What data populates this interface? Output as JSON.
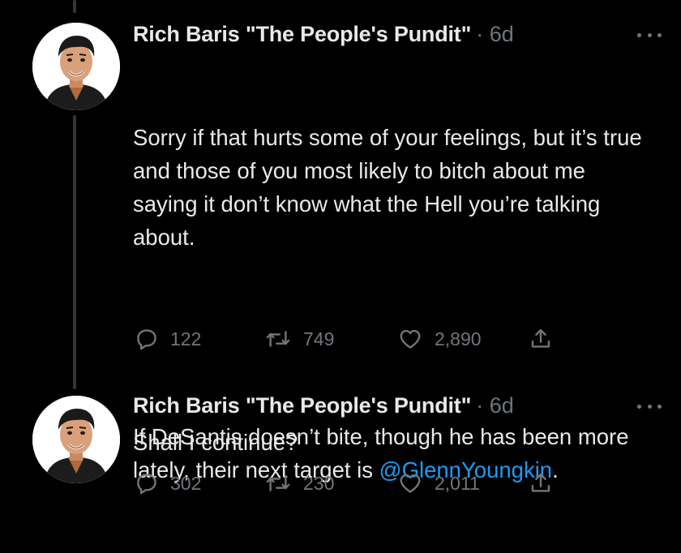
{
  "tweets": [
    {
      "author": "Rich Baris \"The People's Pundit\"",
      "meta": "· 6d",
      "paragraph1": "Sorry if that hurts some of your feelings, but it’s true and those of you most likely to bitch about me saying it don’t know what the Hell you’re talking about.",
      "paragraph2_prefix": "If DeSantis doesn’t bite, though he has been more lately, their next target is ",
      "mention": "@GlennYoungkin",
      "paragraph2_suffix": ".",
      "replies": "122",
      "retweets": "749",
      "likes": "2,890"
    },
    {
      "author": "Rich Baris \"The People's Pundit\"",
      "meta": "· 6d",
      "text": "Shall I continue?",
      "replies": "302",
      "retweets": "230",
      "likes": "2,011"
    }
  ],
  "icons": {
    "reply": "reply-icon",
    "retweet": "retweet-icon",
    "like": "heart-icon",
    "share": "share-icon",
    "more": "more-icon"
  },
  "colors": {
    "background": "#000000",
    "text": "#e7e9ea",
    "secondary": "#71767b",
    "link": "#1d9bf0",
    "thread_line": "#333639"
  }
}
